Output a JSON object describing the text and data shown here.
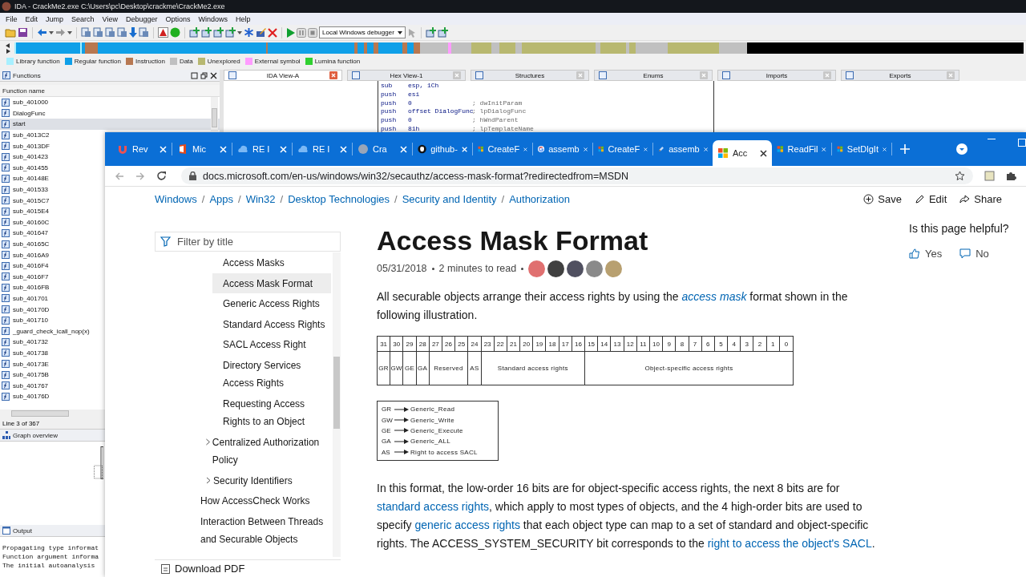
{
  "ida": {
    "title": "IDA - CrackMe2.exe C:\\Users\\pc\\Desktop\\crackme\\CrackMe2.exe",
    "menu": [
      "File",
      "Edit",
      "Jump",
      "Search",
      "View",
      "Debugger",
      "Options",
      "Windows",
      "Help"
    ],
    "debugger_select": "Local Windows debugger",
    "legend": [
      {
        "label": "Library function",
        "color": "#a8f0ff"
      },
      {
        "label": "Regular function",
        "color": "#10a0e8"
      },
      {
        "label": "Instruction",
        "color": "#b87850"
      },
      {
        "label": "Data",
        "color": "#c0c0c0"
      },
      {
        "label": "Unexplored",
        "color": "#b8b870"
      },
      {
        "label": "External symbol",
        "color": "#ff9cff"
      },
      {
        "label": "Lumina function",
        "color": "#30d030"
      }
    ],
    "functions": {
      "title": "Functions",
      "column": "Function name",
      "items": [
        {
          "name": "sub_401000",
          "selected": false
        },
        {
          "name": "DialogFunc",
          "selected": false
        },
        {
          "name": "start",
          "selected": true
        },
        {
          "name": "sub_4013C2",
          "selected": false
        },
        {
          "name": "sub_4013DF",
          "selected": false
        },
        {
          "name": "sub_401423",
          "selected": false
        },
        {
          "name": "sub_401455",
          "selected": false
        },
        {
          "name": "sub_40148E",
          "selected": false
        },
        {
          "name": "sub_401533",
          "selected": false
        },
        {
          "name": "sub_4015C7",
          "selected": false
        },
        {
          "name": "sub_4015E4",
          "selected": false
        },
        {
          "name": "sub_40160C",
          "selected": false
        },
        {
          "name": "sub_401647",
          "selected": false
        },
        {
          "name": "sub_40165C",
          "selected": false
        },
        {
          "name": "sub_4016A9",
          "selected": false
        },
        {
          "name": "sub_4016F4",
          "selected": false
        },
        {
          "name": "sub_4016F7",
          "selected": false
        },
        {
          "name": "sub_4016FB",
          "selected": false
        },
        {
          "name": "sub_401701",
          "selected": false
        },
        {
          "name": "sub_40170D",
          "selected": false
        },
        {
          "name": "sub_401710",
          "selected": false
        },
        {
          "name": "_guard_check_icall_nop(x)",
          "selected": false
        },
        {
          "name": "sub_401732",
          "selected": false
        },
        {
          "name": "sub_401738",
          "selected": false
        },
        {
          "name": "sub_40173E",
          "selected": false
        },
        {
          "name": "sub_40175B",
          "selected": false
        },
        {
          "name": "sub_401767",
          "selected": false
        },
        {
          "name": "sub_40176D",
          "selected": false
        }
      ],
      "status": "Line 3 of 367"
    },
    "graph_overview": {
      "title": "Graph overview"
    },
    "output": {
      "title": "Output",
      "lines": [
        "Propagating type informat",
        "Function argument informa",
        "The initial autoanalysis"
      ]
    },
    "tabs": [
      {
        "label": "IDA View-A",
        "selected": true
      },
      {
        "label": "Hex View-1",
        "selected": false
      },
      {
        "label": "Structures",
        "selected": false
      },
      {
        "label": "Enums",
        "selected": false
      },
      {
        "label": "Imports",
        "selected": false
      },
      {
        "label": "Exports",
        "selected": false
      }
    ],
    "code": [
      {
        "mnemonic": "sub",
        "operands": "esp, 1Ch"
      },
      {
        "mnemonic": "push",
        "operands": "esi"
      },
      {
        "mnemonic": "push",
        "operands": "0",
        "comment": "; dwInitParam"
      },
      {
        "mnemonic": "push",
        "operands": "offset DialogFunc",
        "comment": "; lpDialogFunc"
      },
      {
        "mnemonic": "push",
        "operands": "0",
        "comment": "; hWndParent"
      },
      {
        "mnemonic": "push",
        "operands": "81h",
        "comment": "; lpTemplateName"
      }
    ]
  },
  "browser": {
    "tabs": [
      {
        "label": "Rev",
        "kind": "udemy",
        "selected": false
      },
      {
        "label": "Mic",
        "kind": "office",
        "selected": false
      },
      {
        "label": "RE I",
        "kind": "cloud",
        "selected": false
      },
      {
        "label": "RE I",
        "kind": "cloud",
        "selected": false
      },
      {
        "label": "Cra",
        "kind": "globe",
        "selected": false
      },
      {
        "label": "github-",
        "kind": "github",
        "selected": false
      },
      {
        "label": "CreateF",
        "kind": "windows",
        "selected": false
      },
      {
        "label": "assemb",
        "kind": "google",
        "selected": false
      },
      {
        "label": "CreateF",
        "kind": "windows",
        "selected": false
      },
      {
        "label": "assemb",
        "kind": "pen",
        "selected": false
      },
      {
        "label": "Acc",
        "kind": "windows",
        "selected": true
      },
      {
        "label": "ReadFil",
        "kind": "windows",
        "selected": false
      },
      {
        "label": "SetDlgIt",
        "kind": "windows",
        "selected": false
      }
    ],
    "url": "docs.microsoft.com/en-us/windows/win32/secauthz/access-mask-format?redirectedfrom=MSDN",
    "breadcrumb": [
      "Windows",
      "Apps",
      "Win32",
      "Desktop Technologies",
      "Security and Identity",
      "Authorization"
    ],
    "breadcrumb_separator": "/",
    "actions": [
      {
        "label": "Save",
        "kind": "save"
      },
      {
        "label": "Edit",
        "kind": "edit"
      },
      {
        "label": "Share",
        "kind": "share"
      }
    ],
    "filter_placeholder": "Filter by title",
    "toc": [
      {
        "label": "Access Masks",
        "kind": "page",
        "selected": false
      },
      {
        "label": "Access Mask Format",
        "kind": "page",
        "selected": true
      },
      {
        "label": "Generic Access Rights",
        "kind": "page",
        "selected": false
      },
      {
        "label": "Standard Access Rights",
        "kind": "page",
        "selected": false
      },
      {
        "label": "SACL Access Right",
        "kind": "page",
        "selected": false
      },
      {
        "label": "Directory Services Access Rights",
        "kind": "page",
        "selected": false
      },
      {
        "label": "Requesting Access Rights to an Object",
        "kind": "page",
        "selected": false
      },
      {
        "label": "Centralized Authorization Policy",
        "kind": "section",
        "selected": false
      },
      {
        "label": "Security Identifiers",
        "kind": "section",
        "selected": false
      },
      {
        "label": "How AccessCheck Works",
        "kind": "topic",
        "selected": false
      },
      {
        "label": "Interaction Between Threads and Securable Objects",
        "kind": "topic",
        "selected": false
      }
    ],
    "download": "Download PDF",
    "article": {
      "title": "Access Mask Format",
      "date": "05/31/2018",
      "read_time": "2 minutes to read",
      "contributors": [
        {
          "color": "#e07070"
        },
        {
          "color": "#404040"
        },
        {
          "color": "#505060"
        },
        {
          "color": "#8a8a8a"
        },
        {
          "color": "#b8a070"
        }
      ],
      "intro": [
        {
          "kind": "text",
          "text": "All securable objects arrange their access rights by using the "
        },
        {
          "kind": "em_link",
          "text": "access mask"
        },
        {
          "kind": "text",
          "text": " format shown in the following illustration."
        }
      ],
      "diagram": {
        "fields": [
          {
            "label": "GR",
            "bits": [
              "31"
            ]
          },
          {
            "label": "GW",
            "bits": [
              "30"
            ]
          },
          {
            "label": "GE",
            "bits": [
              "29"
            ]
          },
          {
            "label": "GA",
            "bits": [
              "28"
            ]
          },
          {
            "label": "Reserved",
            "bits": [
              "27",
              "26",
              "25"
            ]
          },
          {
            "label": "AS",
            "bits": [
              "24"
            ]
          },
          {
            "label": "Standard access rights",
            "bits": [
              "23",
              "22",
              "21",
              "20",
              "19",
              "18",
              "17",
              "16"
            ]
          },
          {
            "label": "Object-specific access rights",
            "bits": [
              "15",
              "14",
              "13",
              "12",
              "11",
              "10",
              "9",
              "8",
              "7",
              "6",
              "5",
              "4",
              "3",
              "2",
              "1",
              "0"
            ]
          }
        ],
        "legend": [
          {
            "code": "GR",
            "meaning": "Generic_Read"
          },
          {
            "code": "GW",
            "meaning": "Generic_Write"
          },
          {
            "code": "GE",
            "meaning": "Generic_Execute"
          },
          {
            "code": "GA",
            "meaning": "Generic_ALL"
          },
          {
            "code": "AS",
            "meaning": "Right to access SACL"
          }
        ]
      },
      "body": [
        {
          "kind": "text",
          "text": "In this format, the low-order 16 bits are for object-specific access rights, the next 8 bits are for "
        },
        {
          "kind": "link",
          "text": "standard access rights"
        },
        {
          "kind": "text",
          "text": ", which apply to most types of objects, and the 4 high-order bits are used to specify "
        },
        {
          "kind": "link",
          "text": "generic access rights"
        },
        {
          "kind": "text",
          "text": " that each object type can map to a set of standard and object-specific rights. The ACCESS_SYSTEM_SECURITY bit corresponds to the "
        },
        {
          "kind": "link",
          "text": "right to access the object's SACL"
        },
        {
          "kind": "text",
          "text": "."
        }
      ]
    },
    "helpful": {
      "question": "Is this page helpful?",
      "yes": "Yes",
      "no": "No"
    }
  }
}
